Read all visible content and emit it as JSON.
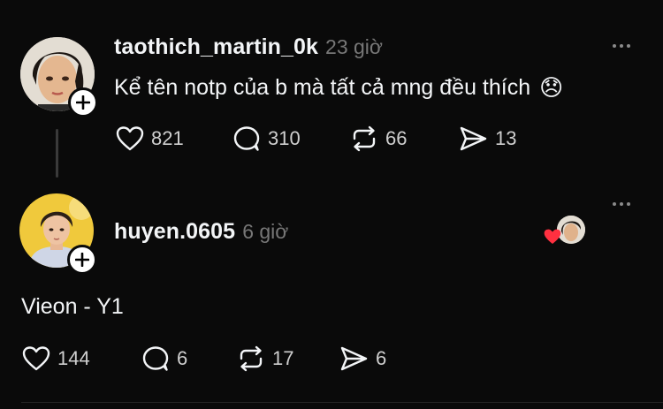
{
  "post": {
    "username": "taothich_martin_0k",
    "time": "23 giờ",
    "text": "Kể tên notp của b mà tất cả mng đều thích",
    "emoji": "😞",
    "counts": {
      "likes": "821",
      "replies": "310",
      "reposts": "66",
      "shares": "13"
    }
  },
  "reply": {
    "username": "huyen.0605",
    "time": "6 giờ",
    "text": "Vieon - Y1",
    "counts": {
      "likes": "144",
      "replies": "6",
      "reposts": "17",
      "shares": "6"
    }
  },
  "icons": {
    "like": "heart-icon",
    "reply": "comment-bubble-icon",
    "repost": "repost-arrows-icon",
    "share": "send-icon",
    "follow": "plus-icon",
    "more": "more-dots-icon"
  },
  "colors": {
    "background": "#0a0a0a",
    "text": "#f3f5f7",
    "muted": "#777777",
    "liked_heart": "#ff3040"
  }
}
